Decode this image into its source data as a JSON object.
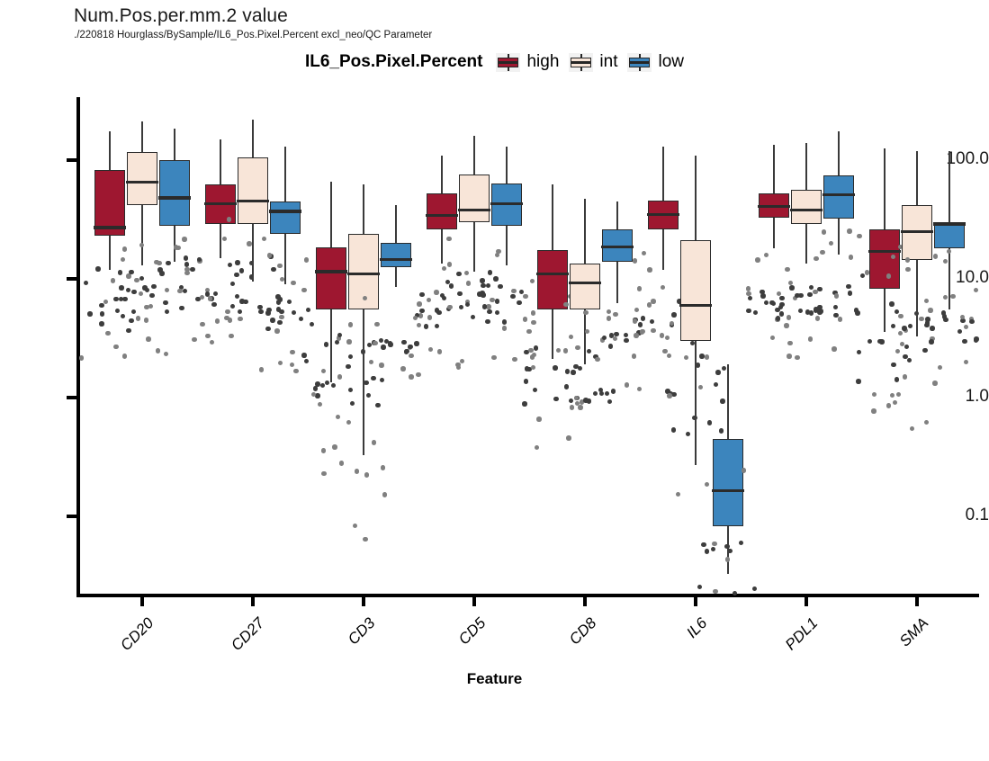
{
  "header": {
    "title": "Num.Pos.per.mm.2 value",
    "subtitle": "./220818 Hourglass/BySample/IL6_Pos.Pixel.Percent excl_neo/QC Parameter"
  },
  "legend": {
    "title": "IL6_Pos.Pixel.Percent",
    "items": [
      {
        "label": "high",
        "color": "#9e1730"
      },
      {
        "label": "int",
        "color": "#f8e5d8"
      },
      {
        "label": "low",
        "color": "#3c85bd"
      }
    ]
  },
  "colors": {
    "high": "#9e1730",
    "int": "#f8e5d8",
    "low": "#3c85bd",
    "outline": "#2b2b2b",
    "point": "#808080"
  },
  "chart_data": {
    "type": "box",
    "title": "Num.Pos.per.mm.2 value",
    "subtitle": "./220818 Hourglass/BySample/IL6_Pos.Pixel.Percent excl_neo/QC Parameter",
    "xlabel": "Feature",
    "ylabel": "",
    "yscale": "log10",
    "ylim": [
      0.028,
      320
    ],
    "grid": false,
    "legend_position": "top-center",
    "legend_title": "IL6_Pos.Pixel.Percent",
    "categories": [
      "CD20",
      "CD27",
      "CD3",
      "CD5",
      "CD8",
      "IL6",
      "PDL1",
      "SMA"
    ],
    "ytick_labels": [
      "100.0",
      "10.0",
      "1.0",
      "0.1"
    ],
    "ytick_values": [
      100.0,
      10.0,
      1.0,
      0.1
    ],
    "series": [
      {
        "name": "high",
        "color": "#9e1730",
        "boxes": [
          {
            "category": "CD20",
            "lower_whisker": 12.0,
            "q1": 23.0,
            "median": 27.0,
            "q3": 82.0,
            "upper_whisker": 175.0
          },
          {
            "category": "CD27",
            "lower_whisker": 15.0,
            "q1": 29.0,
            "median": 43.0,
            "q3": 62.0,
            "upper_whisker": 150.0
          },
          {
            "category": "CD3",
            "lower_whisker": 1.35,
            "q1": 5.5,
            "median": 11.5,
            "q3": 18.5,
            "upper_whisker": 66.0
          },
          {
            "category": "CD5",
            "lower_whisker": 13.5,
            "q1": 26.0,
            "median": 34.0,
            "q3": 52.0,
            "upper_whisker": 110.0
          },
          {
            "category": "CD8",
            "lower_whisker": 2.1,
            "q1": 5.5,
            "median": 11.0,
            "q3": 17.5,
            "upper_whisker": 62.0
          },
          {
            "category": "IL6",
            "lower_whisker": 12.0,
            "q1": 26.0,
            "median": 35.0,
            "q3": 46.0,
            "upper_whisker": 130.0
          },
          {
            "category": "PDL1",
            "lower_whisker": 18.0,
            "q1": 33.0,
            "median": 41.0,
            "q3": 52.0,
            "upper_whisker": 135.0
          },
          {
            "category": "SMA",
            "lower_whisker": 3.6,
            "q1": 8.2,
            "median": 17.0,
            "q3": 26.0,
            "upper_whisker": 125.0
          }
        ]
      },
      {
        "name": "int",
        "color": "#f8e5d8",
        "boxes": [
          {
            "category": "CD20",
            "lower_whisker": 13.0,
            "q1": 42.0,
            "median": 65.0,
            "q3": 118.0,
            "upper_whisker": 210.0
          },
          {
            "category": "CD27",
            "lower_whisker": 9.5,
            "q1": 29.0,
            "median": 45.0,
            "q3": 105.0,
            "upper_whisker": 220.0
          },
          {
            "category": "CD3",
            "lower_whisker": 0.33,
            "q1": 5.5,
            "median": 11.0,
            "q3": 24.0,
            "upper_whisker": 62.0
          },
          {
            "category": "CD5",
            "lower_whisker": 11.5,
            "q1": 30.0,
            "median": 38.0,
            "q3": 76.0,
            "upper_whisker": 160.0
          },
          {
            "category": "CD8",
            "lower_whisker": 1.9,
            "q1": 5.5,
            "median": 9.3,
            "q3": 13.5,
            "upper_whisker": 47.0
          },
          {
            "category": "IL6",
            "lower_whisker": 0.27,
            "q1": 3.0,
            "median": 6.0,
            "q3": 21.0,
            "upper_whisker": 110.0
          },
          {
            "category": "PDL1",
            "lower_whisker": 13.5,
            "q1": 29.0,
            "median": 38.0,
            "q3": 56.0,
            "upper_whisker": 140.0
          },
          {
            "category": "SMA",
            "lower_whisker": 3.3,
            "q1": 14.5,
            "median": 25.0,
            "q3": 42.0,
            "upper_whisker": 120.0
          }
        ]
      },
      {
        "name": "low",
        "color": "#3c85bd",
        "boxes": [
          {
            "category": "CD20",
            "lower_whisker": 14.0,
            "q1": 28.0,
            "median": 48.0,
            "q3": 100.0,
            "upper_whisker": 185.0
          },
          {
            "category": "CD27",
            "lower_whisker": 9.0,
            "q1": 24.0,
            "median": 37.0,
            "q3": 45.0,
            "upper_whisker": 130.0
          },
          {
            "category": "CD3",
            "lower_whisker": 8.5,
            "q1": 12.5,
            "median": 14.5,
            "q3": 20.0,
            "upper_whisker": 42.0
          },
          {
            "category": "CD5",
            "lower_whisker": 13.0,
            "q1": 28.0,
            "median": 43.0,
            "q3": 64.0,
            "upper_whisker": 130.0
          },
          {
            "category": "CD8",
            "lower_whisker": 6.2,
            "q1": 14.0,
            "median": 18.5,
            "q3": 26.0,
            "upper_whisker": 45.0
          },
          {
            "category": "IL6",
            "lower_whisker": 0.033,
            "q1": 0.082,
            "median": 0.165,
            "q3": 0.45,
            "upper_whisker": 1.9
          },
          {
            "category": "PDL1",
            "lower_whisker": 16.0,
            "q1": 32.0,
            "median": 51.0,
            "q3": 74.0,
            "upper_whisker": 175.0
          },
          {
            "category": "SMA",
            "lower_whisker": 5.5,
            "q1": 18.0,
            "median": 29.0,
            "q3": 30.0,
            "upper_whisker": 120.0
          }
        ]
      }
    ]
  }
}
